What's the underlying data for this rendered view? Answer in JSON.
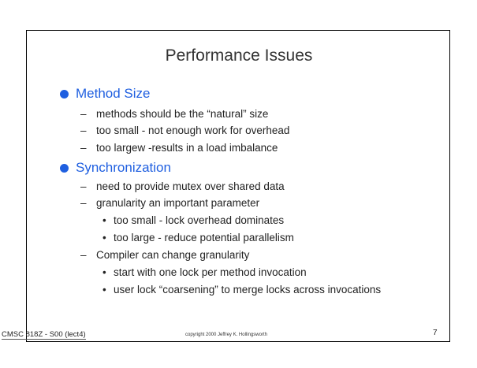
{
  "slide": {
    "title": "Performance Issues",
    "sections": [
      {
        "heading": "Method Size",
        "items": [
          "methods should be the “natural” size",
          "too small - not enough work for overhead",
          "too largew -results in a load imbalance"
        ]
      },
      {
        "heading": "Synchronization",
        "items": [
          "need to provide mutex over shared data",
          "granularity an important parameter",
          "too small - lock overhead dominates",
          "too large - reduce potential parallelism",
          "Compiler can change granularity",
          "start with one lock per method invocation",
          "user lock “coarsening” to merge locks across invocations"
        ]
      }
    ],
    "dash_glyph": "–",
    "dot_glyph": "•"
  },
  "footer": {
    "course": "CMSC 818Z - S00  (lect4)",
    "copyright": "copyright 2000 Jeffrey K. Hollingsworth",
    "page_number": "7"
  },
  "colors": {
    "heading": "#1f5fe0",
    "bullet": "#1f5fe0",
    "text": "#222222"
  }
}
